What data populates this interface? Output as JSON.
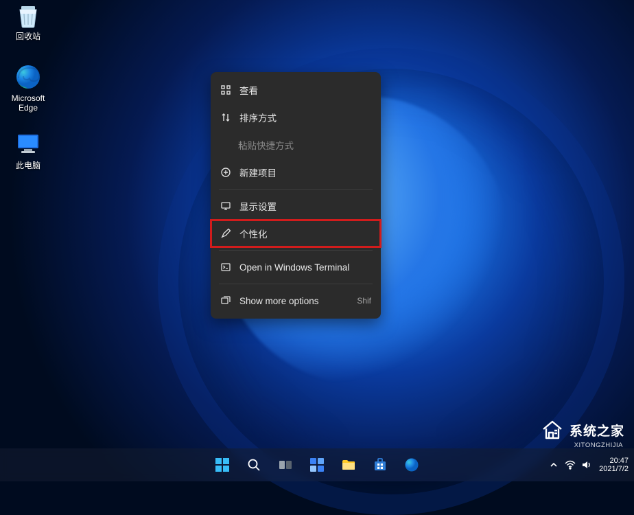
{
  "desktop": {
    "icons": {
      "recycle": {
        "label": "回收站"
      },
      "edge": {
        "label": "Microsoft Edge"
      },
      "thispc": {
        "label": "此电脑"
      }
    }
  },
  "context_menu": {
    "view": {
      "label": "查看"
    },
    "sort": {
      "label": "排序方式"
    },
    "paste_shortcut": {
      "label": "粘贴快捷方式"
    },
    "new": {
      "label": "新建项目"
    },
    "display": {
      "label": "显示设置"
    },
    "personalize": {
      "label": "个性化"
    },
    "terminal": {
      "label": "Open in Windows Terminal"
    },
    "more": {
      "label": "Show more options",
      "shortcut": "Shif"
    }
  },
  "taskbar": {
    "tray": {
      "time": "20:47",
      "date": "2021/7/2"
    }
  },
  "watermark": {
    "brand": "系统之家",
    "sub": "XITONGZHIJIA"
  }
}
